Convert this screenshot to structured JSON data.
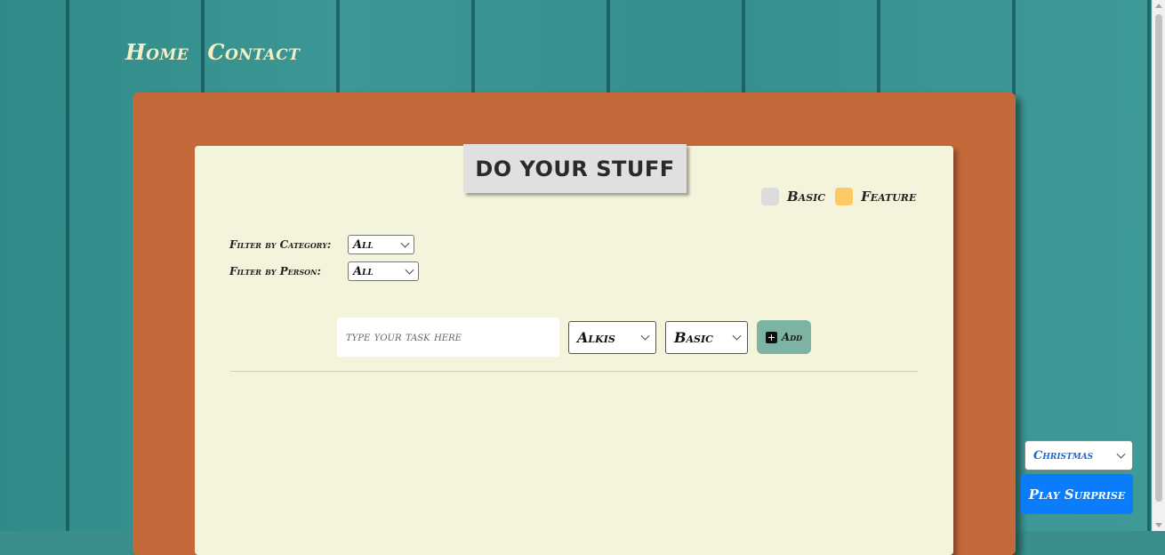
{
  "nav": {
    "home": "Home",
    "contact": "Contact"
  },
  "title": "DO YOUR STUFF",
  "legend": [
    {
      "label": "Basic",
      "color": "#dcdcdc"
    },
    {
      "label": "Feature",
      "color": "#fcc964"
    }
  ],
  "filters": {
    "category_label": "Filter by Category:",
    "category_value": "All",
    "person_label": "Filter by Person:",
    "person_value": "All"
  },
  "task_form": {
    "placeholder": "type your task here",
    "person_value": "Alkis",
    "type_value": "Basic",
    "add_label": "Add"
  },
  "surprise": {
    "theme_value": "Christmas",
    "play_label": "Play Surprise"
  },
  "colors": {
    "frame": "#c4693a",
    "paper": "#f4f4dc",
    "add_button": "#7db3a3",
    "play_button": "#0b7dfa",
    "background": "#3a8f8d"
  }
}
